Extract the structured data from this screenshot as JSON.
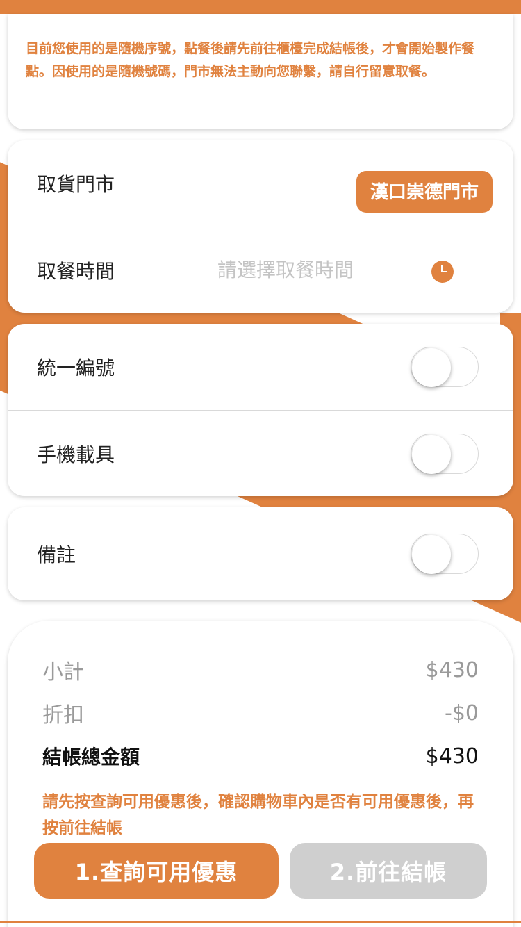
{
  "notice": {
    "text": "目前您使用的是隨機序號，點餐後請先前往櫃檯完成結帳後，才會開始製作餐點。因使用的是隨機號碼，門市無法主動向您聯繫，請自行留意取餐。"
  },
  "pickup": {
    "store_label": "取貨門市",
    "store_value": "漢口崇德門市",
    "time_label": "取餐時間",
    "time_placeholder": "請選擇取餐時間",
    "time_icon": "clock-icon"
  },
  "invoice": {
    "tax_id_label": "統一編號",
    "tax_id_enabled": false,
    "carrier_label": "手機載具",
    "carrier_enabled": false
  },
  "note": {
    "label": "備註",
    "enabled": false
  },
  "summary": {
    "subtotal_label": "小計",
    "subtotal_value": "$430",
    "discount_label": "折扣",
    "discount_value": "-$0",
    "total_label": "結帳總金額",
    "total_value": "$430",
    "warning": "請先按查詢可用優惠後，確認購物車內是否有可用優惠後，再按前往結帳"
  },
  "actions": {
    "query_label": "1.查詢可用優惠",
    "checkout_label": "2.前往結帳"
  },
  "colors": {
    "accent": "#e0823f",
    "disabled": "#cfcfcf",
    "placeholder": "#c4c4c4"
  }
}
